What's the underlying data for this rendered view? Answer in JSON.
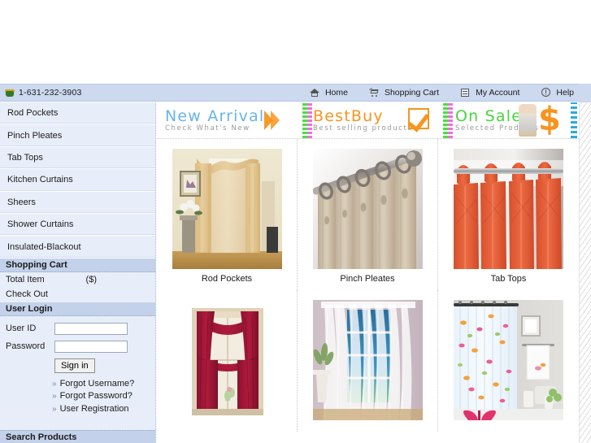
{
  "topbar": {
    "phone_icon": "phone-icon",
    "phone": "1-631-232-3903",
    "nav": [
      {
        "icon": "home-icon",
        "label": "Home"
      },
      {
        "icon": "cart-icon",
        "label": "Shopping Cart"
      },
      {
        "icon": "account-icon",
        "label": "My Account"
      },
      {
        "icon": "help-icon",
        "label": "Help"
      }
    ]
  },
  "sidebar": {
    "categories": [
      {
        "label": "Rod Pockets"
      },
      {
        "label": "Pinch Pleates"
      },
      {
        "label": "Tab Tops"
      },
      {
        "label": "Kitchen Curtains"
      },
      {
        "label": "Sheers"
      },
      {
        "label": "Shower Curtains"
      },
      {
        "label": "Insulated-Blackout"
      }
    ],
    "cart": {
      "heading": "Shopping Cart",
      "total_label": "Total Item",
      "total_value": "($)",
      "checkout_label": "Check Out"
    },
    "login": {
      "heading": "User Login",
      "userid_label": "User ID",
      "userid_value": "",
      "password_label": "Password",
      "password_value": "",
      "signin_label": "Sign in",
      "links": [
        {
          "bullet": "»",
          "label": "Forgot Username?"
        },
        {
          "bullet": "»",
          "label": "Forgot Password?"
        },
        {
          "bullet": "»",
          "label": "User Registration"
        }
      ]
    },
    "search": {
      "heading": "Search Products"
    }
  },
  "promos": [
    {
      "title": "New Arrival",
      "subtitle": "Check What's New",
      "color": "#67b4ec",
      "deco": "chevron-arrows-icon"
    },
    {
      "title": "BestBuy",
      "subtitle": "Best selling products",
      "color": "#f7941e",
      "deco": "checkmark-icon"
    },
    {
      "title": "On Sale",
      "subtitle": "Selected Products",
      "color": "#49d43f",
      "deco": "dollar-sign-icon"
    }
  ],
  "products": {
    "row1": [
      {
        "caption": "Rod Pockets",
        "image": "gold-sheer-curtain-photo"
      },
      {
        "caption": "Pinch Pleates",
        "image": "pleated-curtain-rod-rings-photo"
      },
      {
        "caption": "Tab Tops",
        "image": "orange-tab-top-curtain-photo"
      }
    ],
    "row2": [
      {
        "caption": "",
        "image": "burgundy-kitchen-curtain-photo"
      },
      {
        "caption": "",
        "image": "white-sheer-window-curtain-photo"
      },
      {
        "caption": "",
        "image": "butterfly-shower-curtain-photo"
      }
    ]
  }
}
